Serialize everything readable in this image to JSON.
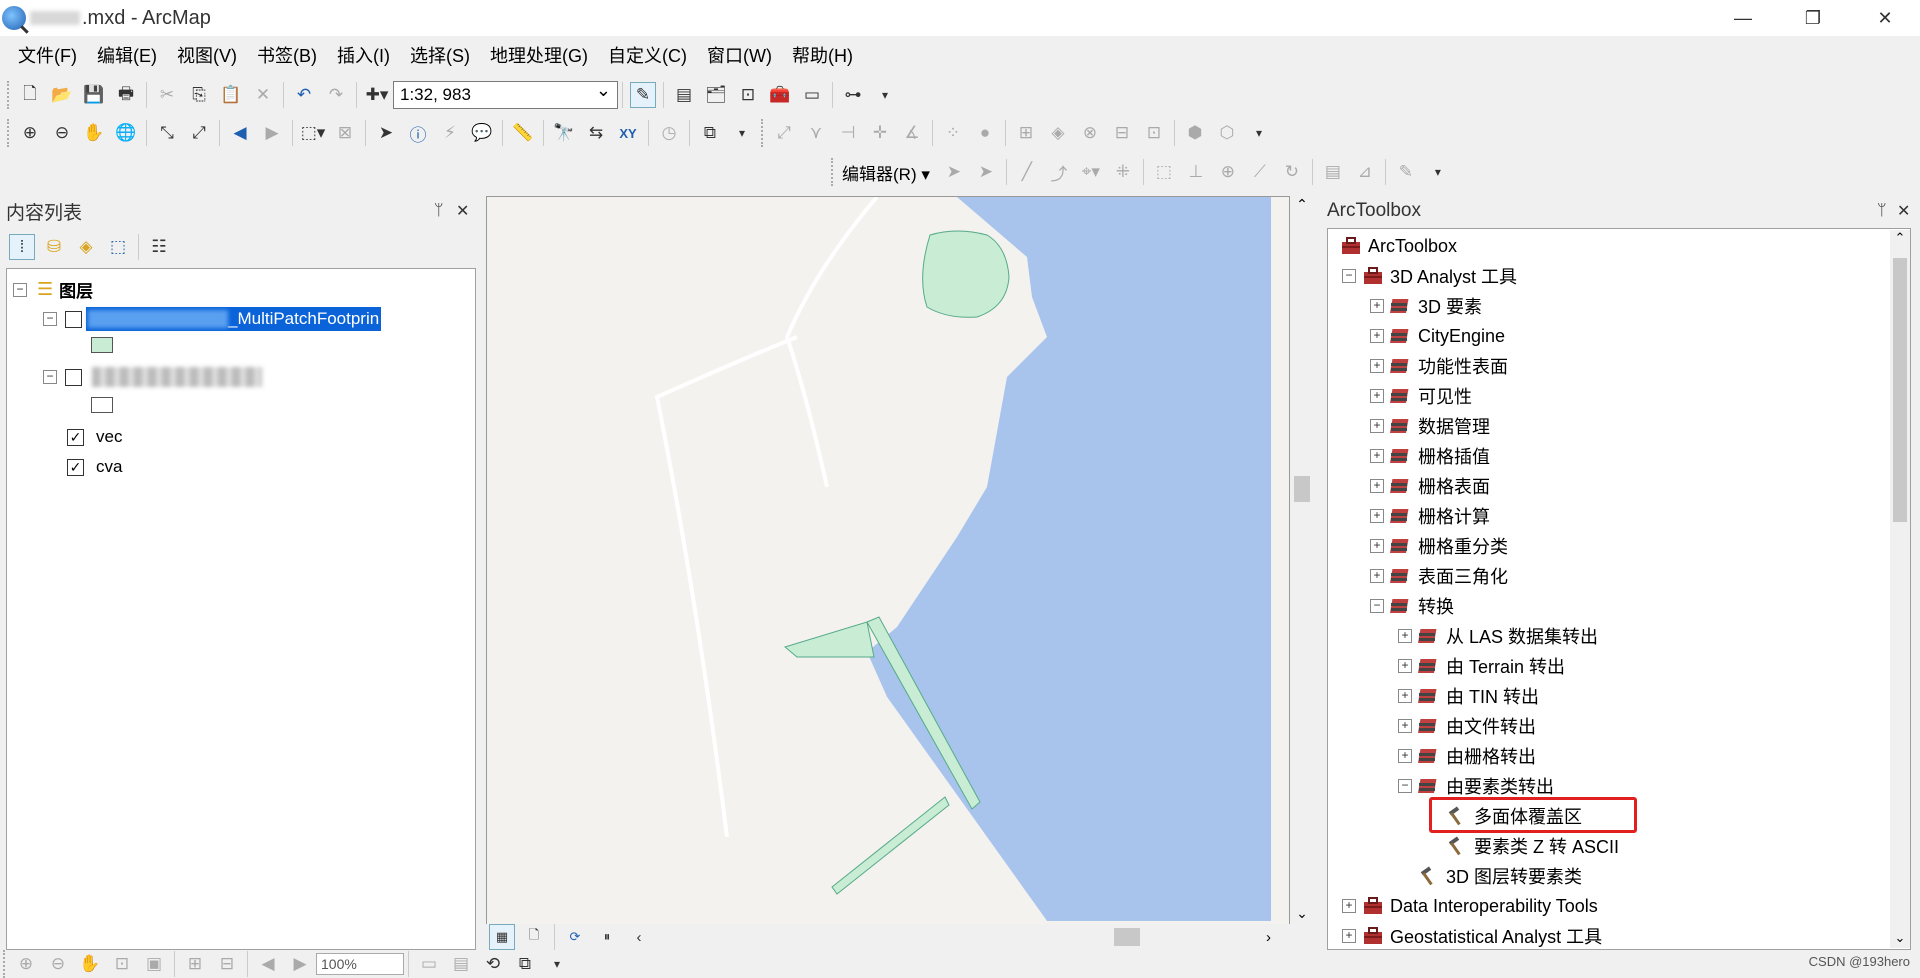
{
  "window": {
    "title": ".mxd - ArcMap",
    "minimize_label": "—",
    "restore_label": "❐",
    "close_label": "✕"
  },
  "menu": [
    {
      "label": "文件(F)"
    },
    {
      "label": "编辑(E)"
    },
    {
      "label": "视图(V)"
    },
    {
      "label": "书签(B)"
    },
    {
      "label": "插入(I)"
    },
    {
      "label": "选择(S)"
    },
    {
      "label": "地理处理(G)"
    },
    {
      "label": "自定义(C)"
    },
    {
      "label": "窗口(W)"
    },
    {
      "label": "帮助(H)"
    }
  ],
  "toolbar": {
    "scale_value": "1:32, 983",
    "editor_label": "编辑器(R) ▾"
  },
  "toc": {
    "title": "内容列表",
    "pin": "ᛘ",
    "close": "✕",
    "root_label": "图层",
    "layer1_label": "_MultiPatchFootprin",
    "layer1_swatch_color": "#c9ecd4",
    "layer3_label": "vec",
    "layer4_label": "cva",
    "checkmark": "✓",
    "minus": "−"
  },
  "arctoolbox": {
    "title": "ArcToolbox",
    "pin": "ᛘ",
    "close": "✕",
    "items": [
      {
        "label": "ArcToolbox",
        "level": 0,
        "expander": "",
        "icon": "toolbox-icon"
      },
      {
        "label": "3D Analyst 工具",
        "level": 1,
        "expander": "−",
        "icon": "toolbox-icon"
      },
      {
        "label": "3D 要素",
        "level": 2,
        "expander": "+",
        "icon": "toolset-icon"
      },
      {
        "label": "CityEngine",
        "level": 2,
        "expander": "+",
        "icon": "toolset-icon"
      },
      {
        "label": "功能性表面",
        "level": 2,
        "expander": "+",
        "icon": "toolset-icon"
      },
      {
        "label": "可见性",
        "level": 2,
        "expander": "+",
        "icon": "toolset-icon"
      },
      {
        "label": "数据管理",
        "level": 2,
        "expander": "+",
        "icon": "toolset-icon"
      },
      {
        "label": "栅格插值",
        "level": 2,
        "expander": "+",
        "icon": "toolset-icon"
      },
      {
        "label": "栅格表面",
        "level": 2,
        "expander": "+",
        "icon": "toolset-icon"
      },
      {
        "label": "栅格计算",
        "level": 2,
        "expander": "+",
        "icon": "toolset-icon"
      },
      {
        "label": "栅格重分类",
        "level": 2,
        "expander": "+",
        "icon": "toolset-icon"
      },
      {
        "label": "表面三角化",
        "level": 2,
        "expander": "+",
        "icon": "toolset-icon"
      },
      {
        "label": "转换",
        "level": 2,
        "expander": "−",
        "icon": "toolset-icon"
      },
      {
        "label": "从 LAS 数据集转出",
        "level": 3,
        "expander": "+",
        "icon": "toolset-icon"
      },
      {
        "label": "由 Terrain 转出",
        "level": 3,
        "expander": "+",
        "icon": "toolset-icon"
      },
      {
        "label": "由 TIN 转出",
        "level": 3,
        "expander": "+",
        "icon": "toolset-icon"
      },
      {
        "label": "由文件转出",
        "level": 3,
        "expander": "+",
        "icon": "toolset-icon"
      },
      {
        "label": "由栅格转出",
        "level": 3,
        "expander": "+",
        "icon": "toolset-icon"
      },
      {
        "label": "由要素类转出",
        "level": 3,
        "expander": "−",
        "icon": "toolset-icon"
      },
      {
        "label": "多面体覆盖区",
        "level": 4,
        "expander": "",
        "icon": "hammer-icon"
      },
      {
        "label": "要素类 Z 转 ASCII",
        "level": 4,
        "expander": "",
        "icon": "hammer-icon"
      },
      {
        "label": "3D 图层转要素类",
        "level": 3,
        "expander": "",
        "icon": "hammer-icon"
      },
      {
        "label": "Data Interoperability Tools",
        "level": 1,
        "expander": "+",
        "icon": "toolbox-icon"
      },
      {
        "label": "Geostatistical Analyst 工具",
        "level": 1,
        "expander": "+",
        "icon": "toolbox-icon"
      }
    ]
  },
  "statusbar": {
    "zoom": "100%"
  },
  "watermark": "CSDN @193hero",
  "colors": {
    "water": "#a9c4ec",
    "land": "#f3f2ef",
    "polygon_fill": "#c9ecd4",
    "selection": "#0a63d8",
    "highlight_box": "#e32020"
  }
}
